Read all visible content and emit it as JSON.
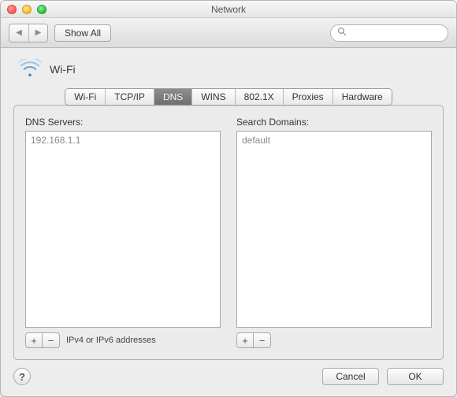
{
  "window": {
    "title": "Network"
  },
  "toolbar": {
    "show_all_label": "Show All",
    "search_placeholder": ""
  },
  "interface": {
    "name": "Wi-Fi"
  },
  "tabs": [
    {
      "label": "Wi-Fi"
    },
    {
      "label": "TCP/IP"
    },
    {
      "label": "DNS"
    },
    {
      "label": "WINS"
    },
    {
      "label": "802.1X"
    },
    {
      "label": "Proxies"
    },
    {
      "label": "Hardware"
    }
  ],
  "active_tab_index": 2,
  "dns": {
    "label": "DNS Servers:",
    "servers": [
      "192.168.1.1"
    ],
    "hint": "IPv4 or IPv6 addresses"
  },
  "search_domains": {
    "label": "Search Domains:",
    "items": [
      "default"
    ]
  },
  "buttons": {
    "cancel": "Cancel",
    "ok": "OK",
    "help": "?"
  },
  "icons": {
    "plus": "+",
    "minus": "−",
    "back": "◀",
    "forward": "▶"
  }
}
